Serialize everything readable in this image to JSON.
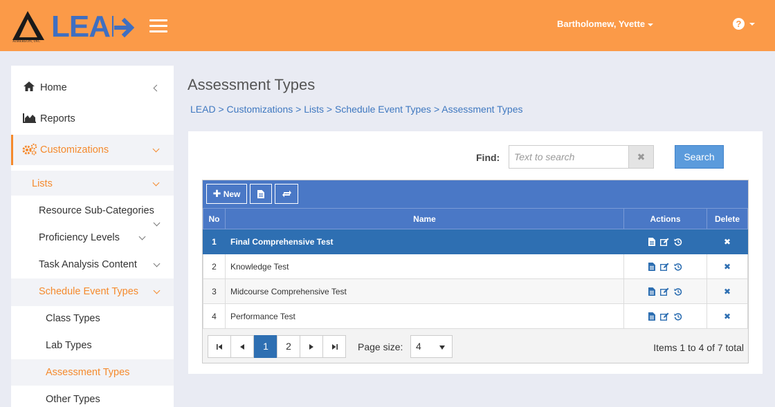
{
  "header": {
    "logo_text": "LEAD",
    "logo_company": "AIMEREON, INC",
    "user_name": "Bartholomew, Yvette",
    "help_symbol": "?",
    "accent_color": "#fb9a48"
  },
  "sidebar": {
    "items": [
      {
        "label": "Home",
        "icon": "home-icon"
      },
      {
        "label": "Reports",
        "icon": "area-chart-icon"
      },
      {
        "label": "Customizations",
        "icon": "gears-icon"
      },
      {
        "label": "Lists"
      },
      {
        "label": "Resource Sub-Categories"
      },
      {
        "label": "Proficiency Levels"
      },
      {
        "label": "Task Analysis Content"
      },
      {
        "label": "Schedule Event Types"
      },
      {
        "label": "Class Types"
      },
      {
        "label": "Lab Types"
      },
      {
        "label": "Assessment Types"
      },
      {
        "label": "Other Types"
      }
    ]
  },
  "main": {
    "title": "Assessment Types",
    "breadcrumb": [
      "LEAD",
      "Customizations",
      "Lists",
      "Schedule Event Types",
      "Assessment Types"
    ],
    "breadcrumb_sep": ">"
  },
  "search": {
    "find_label": "Find:",
    "placeholder": "Text to search",
    "value": "",
    "clear_symbol": "✖",
    "button_label": "Search"
  },
  "toolbar": {
    "new_label": "New"
  },
  "table": {
    "columns": [
      "No",
      "Name",
      "Actions",
      "Delete"
    ],
    "rows": [
      {
        "no": "1",
        "name": "Final Comprehensive Test"
      },
      {
        "no": "2",
        "name": "Knowledge Test"
      },
      {
        "no": "3",
        "name": "Midcourse Comprehensive Test"
      },
      {
        "no": "4",
        "name": "Performance Test"
      }
    ],
    "selected_row": 0
  },
  "pager": {
    "pages": [
      "1",
      "2"
    ],
    "current_page": "1",
    "page_size_label": "Page size:",
    "page_size": "4",
    "items_info": "Items 1 to 4 of 7 total"
  }
}
